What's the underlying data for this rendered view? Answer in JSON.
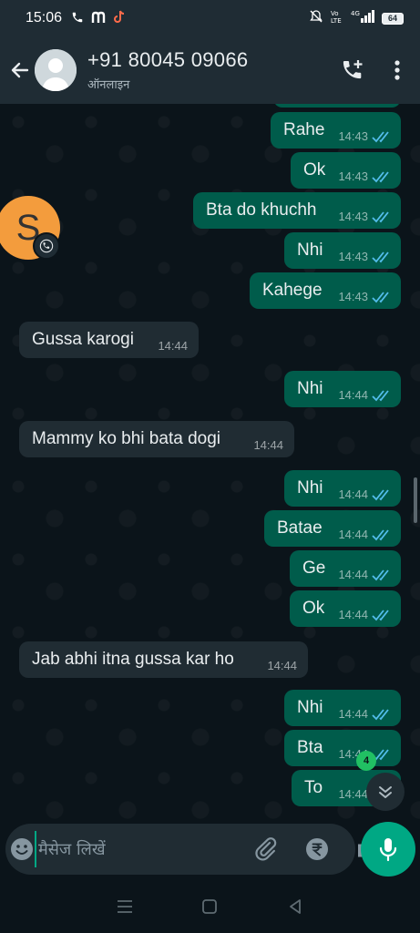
{
  "status_bar": {
    "time": "15:06",
    "left_icons": [
      "phone-icon",
      "m-app-icon",
      "tiktok-icon"
    ],
    "right_icons": [
      "mute-icon",
      "volte-icon",
      "signal-4g-icon"
    ],
    "battery": "64"
  },
  "header": {
    "contact_name": "+91 80045 09066",
    "contact_status": "ऑनलाइन"
  },
  "messages": [
    {
      "dir": "out",
      "text": "Rahe",
      "time": "14:43"
    },
    {
      "dir": "out",
      "text": "Ok",
      "time": "14:43"
    },
    {
      "dir": "out",
      "text": "Bta do khuchh",
      "time": "14:43"
    },
    {
      "dir": "out",
      "text": "Nhi",
      "time": "14:43"
    },
    {
      "dir": "out",
      "text": "Kahege",
      "time": "14:43"
    },
    {
      "dir": "in",
      "text": "Gussa karogi",
      "time": "14:44"
    },
    {
      "dir": "out",
      "text": "Nhi",
      "time": "14:44"
    },
    {
      "dir": "in",
      "text": "Mammy ko bhi bata dogi",
      "time": "14:44"
    },
    {
      "dir": "out",
      "text": "Nhi",
      "time": "14:44"
    },
    {
      "dir": "out",
      "text": "Batae",
      "time": "14:44"
    },
    {
      "dir": "out",
      "text": "Ge",
      "time": "14:44"
    },
    {
      "dir": "out",
      "text": "Ok",
      "time": "14:44"
    },
    {
      "dir": "in",
      "text": "Jab abhi itna gussa kar ho",
      "time": "14:44"
    },
    {
      "dir": "out",
      "text": "Nhi",
      "time": "14:44"
    },
    {
      "dir": "out",
      "text": "Bta",
      "time": "14:44"
    },
    {
      "dir": "out",
      "text": "To",
      "time": "14:44"
    }
  ],
  "floating_avatar": {
    "letter": "S",
    "color": "#f39c3d",
    "badge_icon": "call-icon"
  },
  "unread_count": "4",
  "composer": {
    "placeholder": "मैसेज लिखें",
    "icons": [
      "emoji-icon",
      "attach-icon",
      "rupee-icon",
      "camera-icon"
    ],
    "send_icon": "mic-icon"
  },
  "colors": {
    "outgoing_bubble": "#005c4b",
    "incoming_bubble": "#202c33",
    "accent": "#00a884",
    "read_ticks": "#53bdeb",
    "background": "#0b141a"
  }
}
